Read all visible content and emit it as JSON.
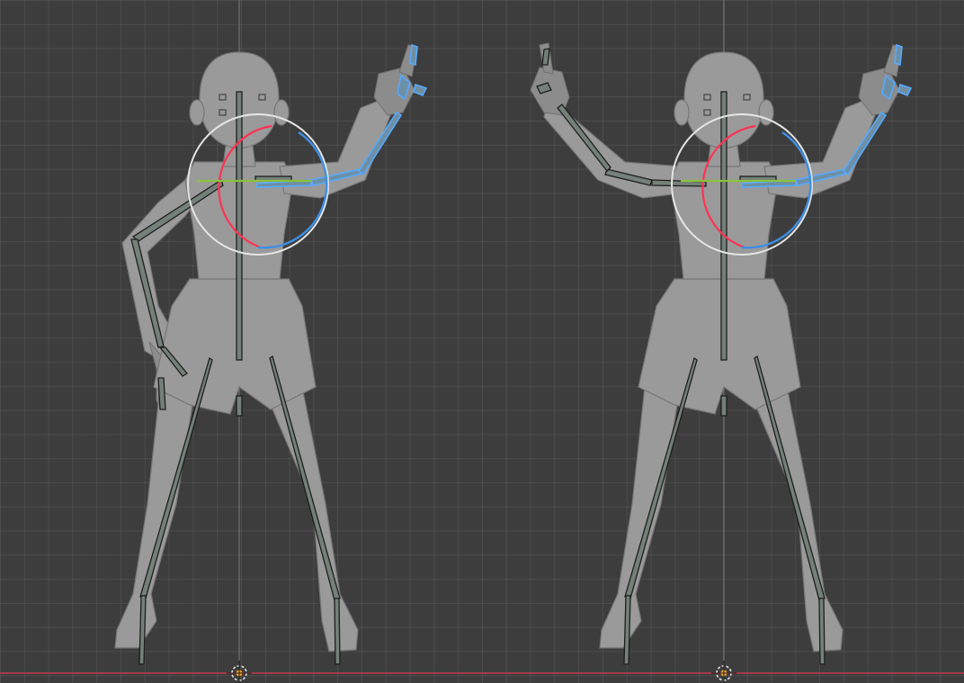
{
  "viewport": {
    "mode": "pose",
    "background": "#3d3d3d",
    "grid": true,
    "x_axis_color": "#c0394a"
  },
  "figures": [
    {
      "id": "left",
      "left_arm": "hand-on-hip",
      "right_arm": "raised-pointing",
      "gizmo": "rotate"
    },
    {
      "id": "right",
      "left_arm": "raised-pointing",
      "right_arm": "raised-pointing",
      "gizmo": "rotate"
    }
  ],
  "gizmo_colors": {
    "x": "#ff3352",
    "y": "#8ac23a",
    "z": "#3d8fe6",
    "view": "#e5e5e5"
  },
  "selection_color": "#55aaff",
  "icons": {
    "origin": "origin-marker-icon"
  }
}
